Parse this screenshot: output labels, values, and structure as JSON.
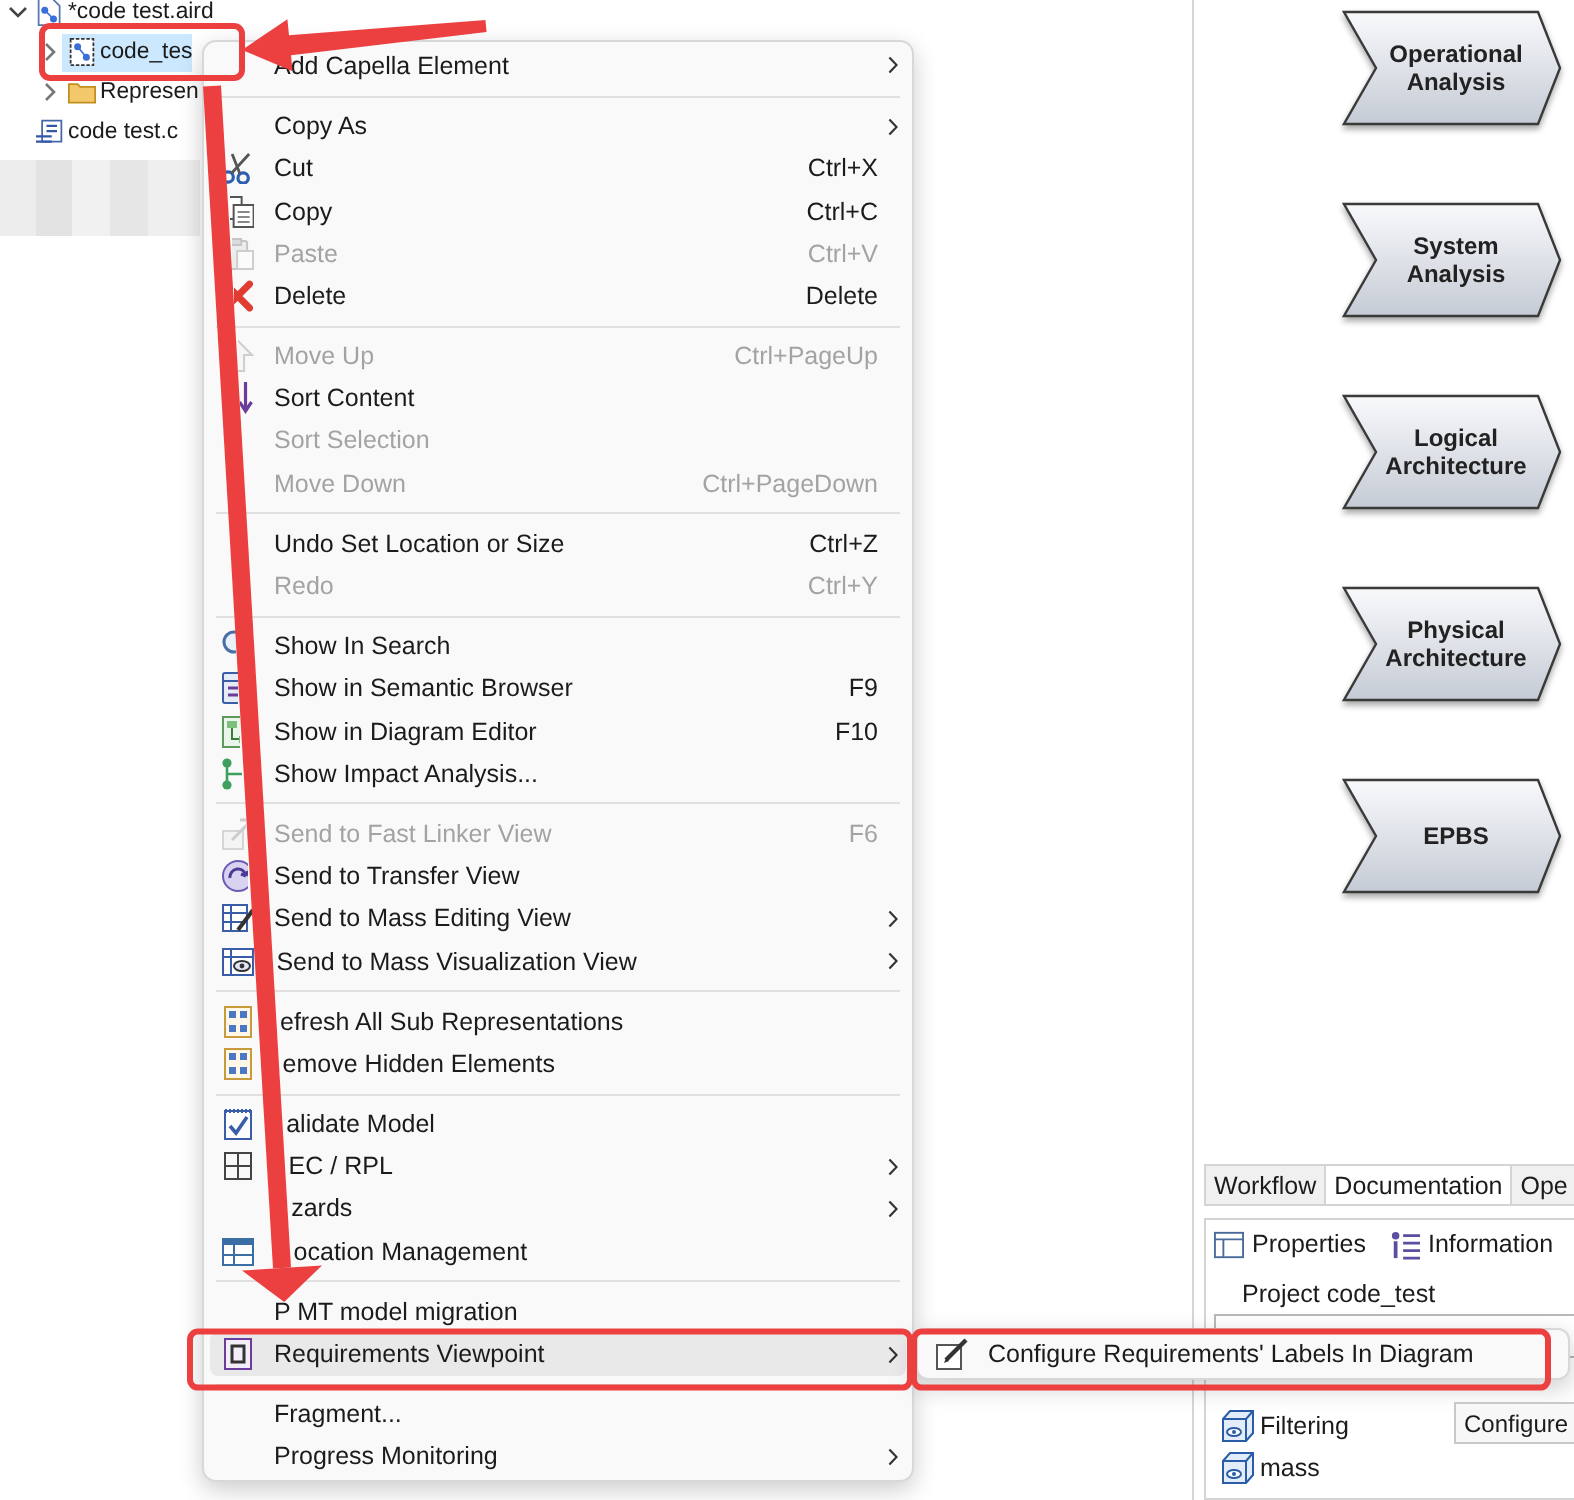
{
  "explorer": {
    "items": [
      {
        "label": "*code test.aird",
        "expanded": true,
        "selected": false,
        "highlighted": false,
        "children": [
          {
            "label": "code_tes",
            "expanded": false,
            "selected": true,
            "highlighted": true
          },
          {
            "label": "Represen",
            "expanded": false,
            "selected": false,
            "highlighted": false
          }
        ]
      },
      {
        "label": "code test.c",
        "selected": false,
        "highlighted": false
      }
    ]
  },
  "context_menu": {
    "items": [
      {
        "kind": "item",
        "label": "Add Capella Element",
        "submenu": true,
        "disabled": false,
        "selected": false,
        "highlighted": false
      },
      {
        "kind": "separator"
      },
      {
        "kind": "item",
        "label": "Copy As",
        "submenu": true,
        "disabled": false,
        "selected": false,
        "highlighted": false
      },
      {
        "kind": "item",
        "label": "Cut",
        "shortcut": "Ctrl+X",
        "submenu": false,
        "disabled": false,
        "selected": false,
        "highlighted": false
      },
      {
        "kind": "item",
        "label": "Copy",
        "shortcut": "Ctrl+C",
        "submenu": false,
        "disabled": false,
        "selected": false,
        "highlighted": false
      },
      {
        "kind": "item",
        "label": "Paste",
        "shortcut": "Ctrl+V",
        "submenu": false,
        "disabled": true,
        "selected": false,
        "highlighted": false
      },
      {
        "kind": "item",
        "label": "Delete",
        "shortcut": "Delete",
        "submenu": false,
        "disabled": false,
        "selected": false,
        "highlighted": false
      },
      {
        "kind": "separator"
      },
      {
        "kind": "item",
        "label": "Move Up",
        "shortcut": "Ctrl+PageUp",
        "submenu": false,
        "disabled": true,
        "selected": false,
        "highlighted": false
      },
      {
        "kind": "item",
        "label": "Sort Content",
        "submenu": false,
        "disabled": false,
        "selected": false,
        "highlighted": false
      },
      {
        "kind": "item",
        "label": "Sort Selection",
        "submenu": false,
        "disabled": true,
        "selected": false,
        "highlighted": false
      },
      {
        "kind": "item",
        "label": "Move Down",
        "shortcut": "Ctrl+PageDown",
        "submenu": false,
        "disabled": true,
        "selected": false,
        "highlighted": false
      },
      {
        "kind": "separator"
      },
      {
        "kind": "item",
        "label": "Undo Set Location or Size",
        "shortcut": "Ctrl+Z",
        "submenu": false,
        "disabled": false,
        "selected": false,
        "highlighted": false
      },
      {
        "kind": "item",
        "label": "Redo",
        "shortcut": "Ctrl+Y",
        "submenu": false,
        "disabled": true,
        "selected": false,
        "highlighted": false
      },
      {
        "kind": "separator"
      },
      {
        "kind": "item",
        "label": "Show In Search",
        "submenu": false,
        "disabled": false,
        "selected": false,
        "highlighted": false
      },
      {
        "kind": "item",
        "label": "Show in Semantic Browser",
        "shortcut": "F9",
        "submenu": false,
        "disabled": false,
        "selected": false,
        "highlighted": false
      },
      {
        "kind": "item",
        "label": "Show in Diagram Editor",
        "shortcut": "F10",
        "submenu": false,
        "disabled": false,
        "selected": false,
        "highlighted": false
      },
      {
        "kind": "item",
        "label": "Show Impact Analysis...",
        "submenu": false,
        "disabled": false,
        "selected": false,
        "highlighted": false
      },
      {
        "kind": "separator"
      },
      {
        "kind": "item",
        "label": "Send to Fast Linker View",
        "shortcut": "F6",
        "submenu": false,
        "disabled": true,
        "selected": false,
        "highlighted": false
      },
      {
        "kind": "item",
        "label": "Send to Transfer View",
        "submenu": false,
        "disabled": false,
        "selected": false,
        "highlighted": false
      },
      {
        "kind": "item",
        "label": "Send to Mass Editing View",
        "submenu": true,
        "disabled": false,
        "selected": false,
        "highlighted": false
      },
      {
        "kind": "item",
        "label": "Send to Mass Visualization View",
        "submenu": true,
        "disabled": false,
        "selected": false,
        "highlighted": false
      },
      {
        "kind": "separator"
      },
      {
        "kind": "item",
        "label": "efresh All Sub Representations",
        "submenu": false,
        "disabled": false,
        "selected": false,
        "highlighted": false
      },
      {
        "kind": "item",
        "label": "emove Hidden Elements",
        "submenu": false,
        "disabled": false,
        "selected": false,
        "highlighted": false
      },
      {
        "kind": "separator"
      },
      {
        "kind": "item",
        "label": "alidate Model",
        "submenu": false,
        "disabled": false,
        "selected": false,
        "highlighted": false
      },
      {
        "kind": "item",
        "label": "EC / RPL",
        "submenu": true,
        "disabled": false,
        "selected": false,
        "highlighted": false
      },
      {
        "kind": "item",
        "label": "zards",
        "submenu": true,
        "disabled": false,
        "selected": false,
        "highlighted": false
      },
      {
        "kind": "item",
        "label": "ocation Management",
        "submenu": false,
        "disabled": false,
        "selected": false,
        "highlighted": false
      },
      {
        "kind": "separator"
      },
      {
        "kind": "item",
        "label": "P MT model migration",
        "submenu": false,
        "disabled": false,
        "selected": false,
        "highlighted": false
      },
      {
        "kind": "item",
        "label": "Requirements Viewpoint",
        "submenu": true,
        "disabled": false,
        "selected": true,
        "highlighted": true
      },
      {
        "kind": "separator"
      },
      {
        "kind": "item",
        "label": "Fragment...",
        "submenu": false,
        "disabled": false,
        "selected": false,
        "highlighted": false
      },
      {
        "kind": "item",
        "label": "Progress Monitoring",
        "submenu": true,
        "disabled": false,
        "selected": false,
        "highlighted": false
      }
    ]
  },
  "submenu": {
    "items": [
      {
        "label": "Configure Requirements' Labels In Diagram",
        "highlighted": true
      }
    ]
  },
  "phase_diagram": {
    "phases": [
      {
        "label": "Operational Analysis"
      },
      {
        "label": "System Analysis"
      },
      {
        "label": "Logical Architecture"
      },
      {
        "label": "Physical Architecture"
      },
      {
        "label": "EPBS"
      }
    ]
  },
  "views": {
    "tabs": [
      {
        "label": "Workflow",
        "selected": false
      },
      {
        "label": "Documentation",
        "selected": true
      },
      {
        "label": "Ope",
        "selected": false
      }
    ]
  },
  "properties_view": {
    "tabs": [
      {
        "label": "Properties"
      },
      {
        "label": "Information"
      }
    ],
    "title": "Project code_test",
    "items": [
      {
        "label": "Filtering"
      },
      {
        "label": "mass"
      }
    ]
  },
  "tooltip": {
    "text": "Configure"
  }
}
